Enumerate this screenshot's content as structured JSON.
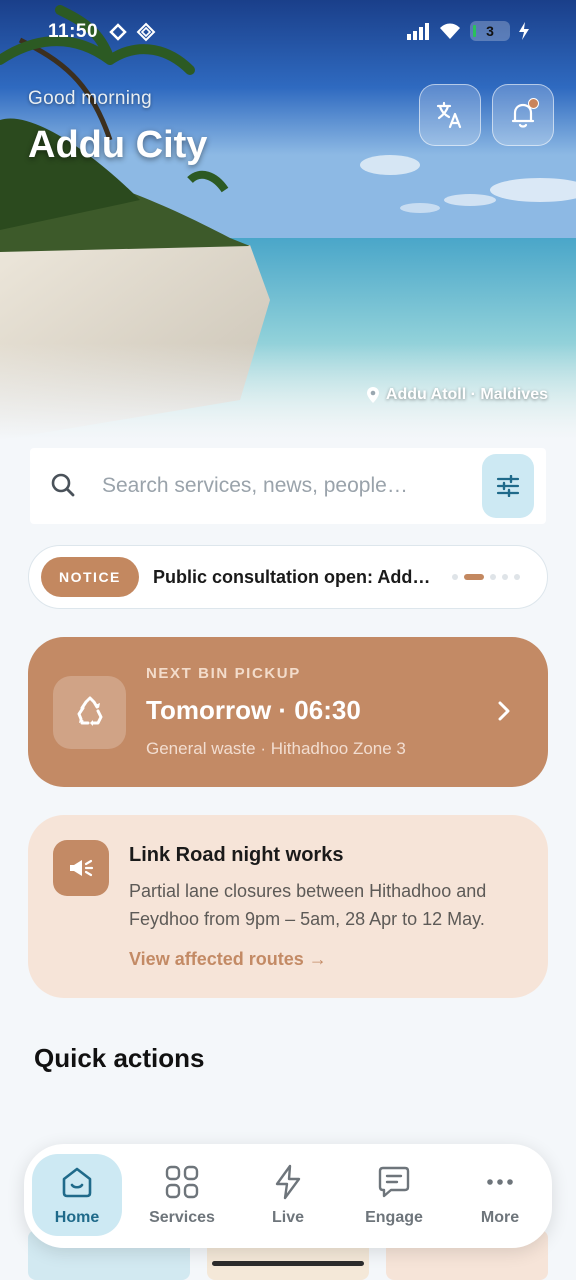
{
  "status_bar": {
    "time": "11:50",
    "battery": "3"
  },
  "header": {
    "greeting": "Good morning",
    "city": "Addu City",
    "location": "Addu Atoll · Maldives"
  },
  "search": {
    "placeholder": "Search services, news, people…"
  },
  "notice": {
    "badge": "NOTICE",
    "text": "Public consultation open: Addu City development plan",
    "dots_count": 5,
    "active_dot": 1
  },
  "bin_pickup": {
    "kicker": "NEXT BIN PICKUP",
    "title": "Tomorrow · 06:30",
    "subtitle": "General waste · Hithadhoo Zone 3"
  },
  "alert": {
    "title": "Link Road night works",
    "body": "Partial lane closures between Hithadhoo and Feydhoo from 9pm – 5am, 28 Apr to 12 May.",
    "link": "View affected routes →"
  },
  "quick_actions": {
    "title": "Quick actions"
  },
  "nav": {
    "items": [
      {
        "label": "Home",
        "icon": "home-icon",
        "active": true
      },
      {
        "label": "Services",
        "icon": "grid-icon",
        "active": false
      },
      {
        "label": "Live",
        "icon": "lightning-icon",
        "active": false
      },
      {
        "label": "Engage",
        "icon": "chat-icon",
        "active": false
      },
      {
        "label": "More",
        "icon": "more-icon",
        "active": false
      }
    ]
  },
  "colors": {
    "accent": "#c38a65",
    "accent_light": "#f6e4d8",
    "nav_active": "#cde9f3",
    "background": "#f4f7fa"
  }
}
